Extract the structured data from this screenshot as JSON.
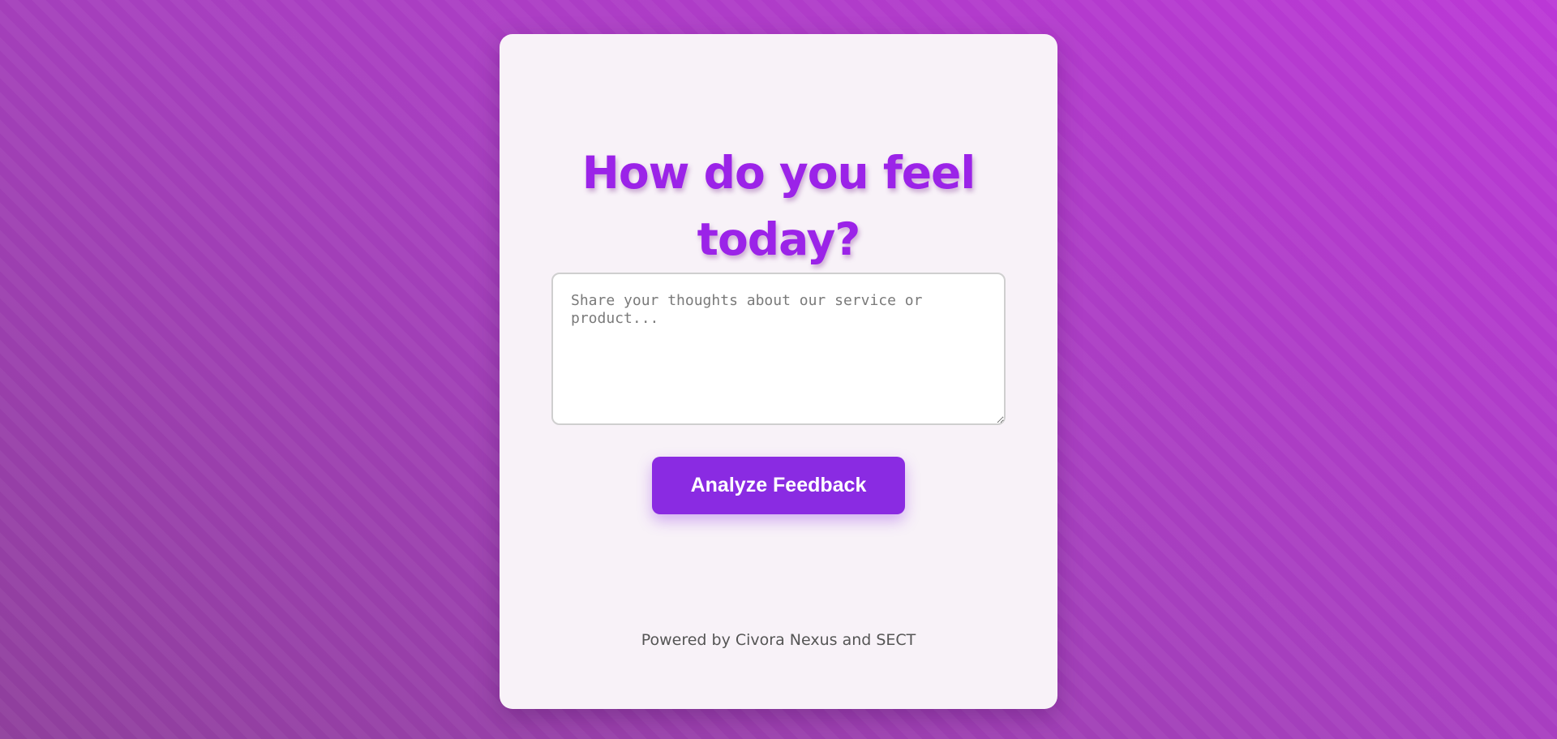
{
  "card": {
    "title_line1": "How do you feel",
    "title_line2": "today?",
    "feedback": {
      "value": "",
      "placeholder": "Share your thoughts about our service or product..."
    },
    "analyze_button_label": "Analyze Feedback",
    "footer_text": "Powered by Civora Nexus and SECT"
  },
  "colors": {
    "accent": "#8a2be2",
    "title": "#9b23e8",
    "card_background": "#f8f2f8",
    "page_background": "#a63fbe"
  }
}
